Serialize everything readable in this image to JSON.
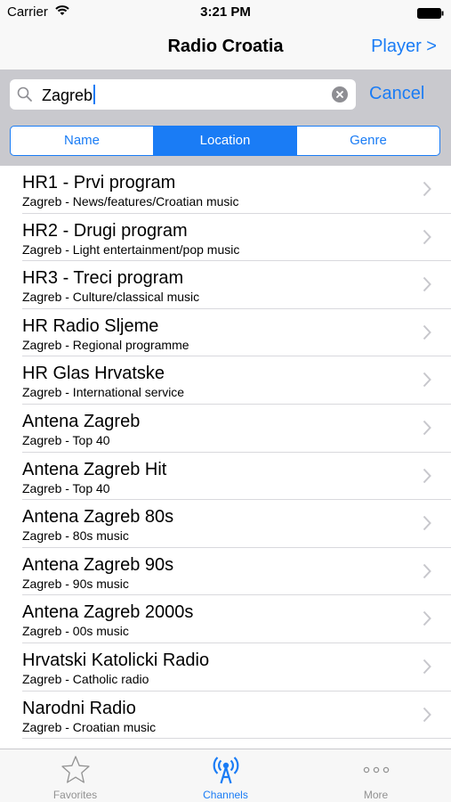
{
  "status_bar": {
    "carrier": "Carrier",
    "time": "3:21 PM"
  },
  "nav": {
    "title": "Radio Croatia",
    "player_label": "Player >"
  },
  "search": {
    "query": "Zagreb",
    "cancel_label": "Cancel"
  },
  "segments": [
    {
      "label": "Name",
      "selected": false
    },
    {
      "label": "Location",
      "selected": true
    },
    {
      "label": "Genre",
      "selected": false
    }
  ],
  "stations": [
    {
      "name": "HR1 - Prvi program",
      "subtitle": "Zagreb - News/features/Croatian music"
    },
    {
      "name": "HR2 - Drugi program",
      "subtitle": "Zagreb - Light entertainment/pop music"
    },
    {
      "name": "HR3 - Treci program",
      "subtitle": "Zagreb - Culture/classical music"
    },
    {
      "name": "HR Radio Sljeme",
      "subtitle": "Zagreb - Regional programme"
    },
    {
      "name": "HR Glas Hrvatske",
      "subtitle": "Zagreb - International service"
    },
    {
      "name": "Antena Zagreb",
      "subtitle": "Zagreb - Top 40"
    },
    {
      "name": "Antena Zagreb Hit",
      "subtitle": "Zagreb - Top 40"
    },
    {
      "name": "Antena Zagreb 80s",
      "subtitle": "Zagreb - 80s music"
    },
    {
      "name": "Antena Zagreb 90s",
      "subtitle": "Zagreb - 90s music"
    },
    {
      "name": "Antena Zagreb 2000s",
      "subtitle": "Zagreb - 00s music"
    },
    {
      "name": "Hrvatski Katolicki Radio",
      "subtitle": "Zagreb - Catholic radio"
    },
    {
      "name": "Narodni Radio",
      "subtitle": "Zagreb - Croatian music"
    }
  ],
  "tabs": [
    {
      "label": "Favorites",
      "icon": "star-icon",
      "active": false
    },
    {
      "label": "Channels",
      "icon": "antenna-icon",
      "active": true
    },
    {
      "label": "More",
      "icon": "more-dots-icon",
      "active": false
    }
  ],
  "colors": {
    "accent": "#1a7cf5",
    "search_bar_bg": "#c9c9ce",
    "inactive_tab": "#929292"
  }
}
